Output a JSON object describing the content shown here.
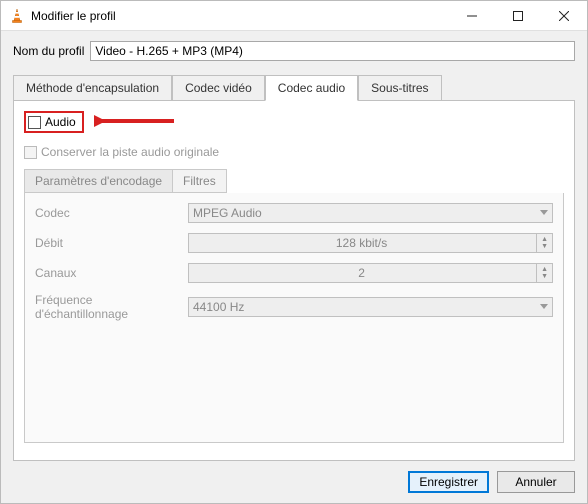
{
  "window": {
    "title": "Modifier le profil"
  },
  "profile": {
    "name_label": "Nom du profil",
    "name_value": "Video - H.265 + MP3 (MP4)"
  },
  "tabs": {
    "encapsulation": "Méthode d'encapsulation",
    "video_codec": "Codec vidéo",
    "audio_codec": "Codec audio",
    "subtitles": "Sous-titres"
  },
  "audio_panel": {
    "audio_checkbox_label": "Audio",
    "keep_original_label": "Conserver la piste audio originale",
    "subtabs": {
      "encoding_params": "Paramètres d'encodage",
      "filters": "Filtres"
    },
    "params": {
      "codec_label": "Codec",
      "codec_value": "MPEG Audio",
      "bitrate_label": "Débit",
      "bitrate_value": "128 kbit/s",
      "channels_label": "Canaux",
      "channels_value": "2",
      "samplerate_label": "Fréquence d'échantillonnage",
      "samplerate_value": "44100 Hz"
    }
  },
  "buttons": {
    "save": "Enregistrer",
    "cancel": "Annuler"
  }
}
